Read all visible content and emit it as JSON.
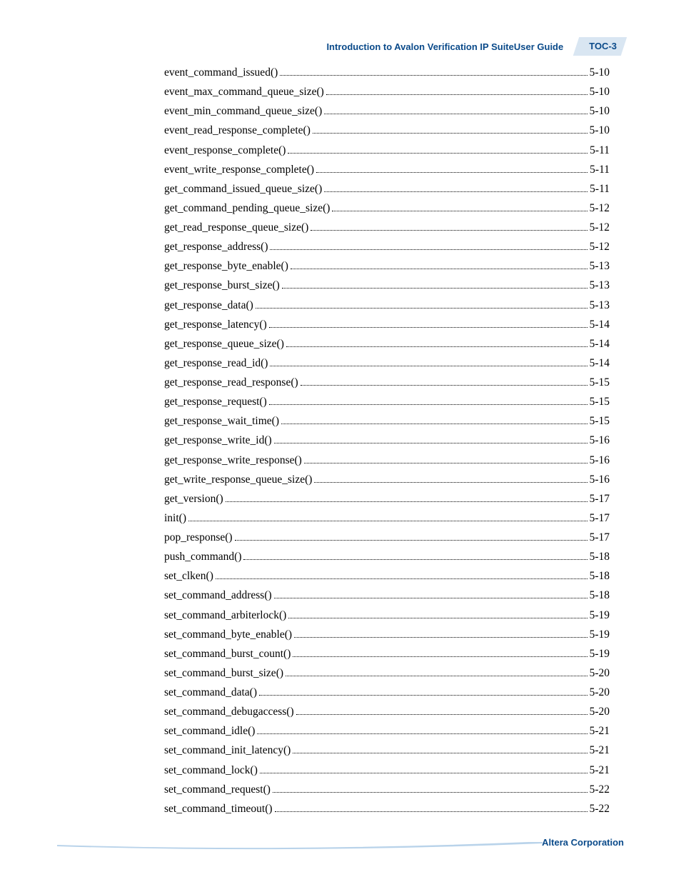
{
  "header": {
    "doc_title": "Introduction to Avalon Verification IP SuiteUser Guide",
    "page_label": "TOC-3"
  },
  "footer": {
    "company": "Altera Corporation"
  },
  "toc": {
    "entries": [
      {
        "label": "event_command_issued()",
        "page": "5-10"
      },
      {
        "label": "event_max_command_queue_size()",
        "page": "5-10"
      },
      {
        "label": "event_min_command_queue_size()",
        "page": "5-10"
      },
      {
        "label": "event_read_response_complete()",
        "page": "5-10"
      },
      {
        "label": "event_response_complete()",
        "page": "5-11"
      },
      {
        "label": "event_write_response_complete()",
        "page": "5-11"
      },
      {
        "label": "get_command_issued_queue_size()",
        "page": "5-11"
      },
      {
        "label": "get_command_pending_queue_size()",
        "page": "5-12"
      },
      {
        "label": "get_read_response_queue_size()",
        "page": "5-12"
      },
      {
        "label": "get_response_address()",
        "page": "5-12"
      },
      {
        "label": "get_response_byte_enable()",
        "page": "5-13"
      },
      {
        "label": "get_response_burst_size()",
        "page": "5-13"
      },
      {
        "label": "get_response_data()",
        "page": "5-13"
      },
      {
        "label": "get_response_latency()",
        "page": "5-14"
      },
      {
        "label": "get_response_queue_size()",
        "page": "5-14"
      },
      {
        "label": "get_response_read_id()",
        "page": "5-14"
      },
      {
        "label": "get_response_read_response()",
        "page": "5-15"
      },
      {
        "label": "get_response_request()",
        "page": "5-15"
      },
      {
        "label": "get_response_wait_time()",
        "page": "5-15"
      },
      {
        "label": "get_response_write_id()",
        "page": "5-16"
      },
      {
        "label": "get_response_write_response()",
        "page": "5-16"
      },
      {
        "label": "get_write_response_queue_size()",
        "page": "5-16"
      },
      {
        "label": "get_version()",
        "page": "5-17"
      },
      {
        "label": "init()",
        "page": "5-17"
      },
      {
        "label": "pop_response()",
        "page": "5-17"
      },
      {
        "label": "push_command()",
        "page": "5-18"
      },
      {
        "label": "set_clken()",
        "page": "5-18"
      },
      {
        "label": "set_command_address()",
        "page": "5-18"
      },
      {
        "label": "set_command_arbiterlock()",
        "page": "5-19"
      },
      {
        "label": "set_command_byte_enable()",
        "page": "5-19"
      },
      {
        "label": "set_command_burst_count()",
        "page": "5-19"
      },
      {
        "label": "set_command_burst_size()",
        "page": "5-20"
      },
      {
        "label": "set_command_data()",
        "page": "5-20"
      },
      {
        "label": "set_command_debugaccess()",
        "page": "5-20"
      },
      {
        "label": "set_command_idle()",
        "page": "5-21"
      },
      {
        "label": "set_command_init_latency()",
        "page": "5-21"
      },
      {
        "label": "set_command_lock()",
        "page": "5-21"
      },
      {
        "label": "set_command_request()",
        "page": "5-22"
      },
      {
        "label": "set_command_timeout()",
        "page": "5-22"
      }
    ]
  }
}
